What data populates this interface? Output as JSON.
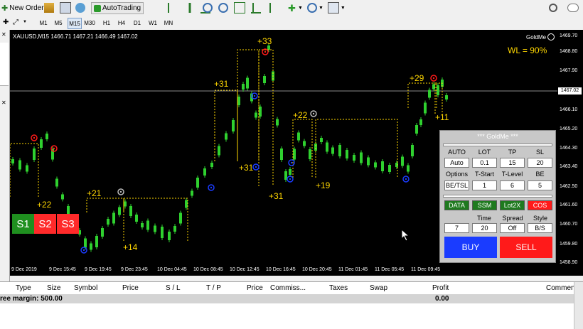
{
  "toolbar": {
    "new_order": "New Order",
    "autotrading": "AutoTrading"
  },
  "timeframes": [
    "M1",
    "M5",
    "M15",
    "M30",
    "H1",
    "H4",
    "D1",
    "W1",
    "MN"
  ],
  "active_timeframe": "M15",
  "chart": {
    "header": "XAUUSD,M15  1466.71 1467.21 1466.49 1467.02",
    "brand": "GoldMe",
    "winloss": "WL = 90%",
    "current_price": "1467.02",
    "price_ticks": [
      "1469.70",
      "1468.80",
      "1467.90",
      "1467.02",
      "1466.10",
      "1465.20",
      "1464.30",
      "1463.40",
      "1462.50",
      "1461.60",
      "1460.70",
      "1459.80",
      "1458.90"
    ],
    "date_ticks": [
      "9 Dec 2019",
      "9 Dec 15:45",
      "9 Dec 19:45",
      "9 Dec 23:45",
      "10 Dec 04:45",
      "10 Dec 08:45",
      "10 Dec 12:45",
      "10 Dec 16:45",
      "10 Dec 20:45",
      "11 Dec 01:45",
      "11 Dec 05:45",
      "11 Dec 09:45"
    ],
    "annotations": [
      "+22",
      "+21",
      "+14",
      "+31",
      "+33",
      "+31",
      "+22",
      "+31",
      "+19",
      "+29",
      "+11"
    ]
  },
  "panel": {
    "title": "*** GoldMe ***",
    "headers1": [
      "AUTO",
      "LOT",
      "TP",
      "SL"
    ],
    "values1": [
      "Auto",
      "0.1",
      "15",
      "20"
    ],
    "headers2": [
      "Options",
      "T-Start",
      "T-Level",
      "BE"
    ],
    "values2": [
      "BE/TSL",
      "1",
      "6",
      "5"
    ],
    "buttons": [
      "DATA",
      "SSM",
      "Lot2X",
      "COS"
    ],
    "headers3": [
      "Time",
      "Spread",
      "Style"
    ],
    "values3": [
      "7",
      "20",
      "Off",
      "B/S"
    ],
    "buy": "BUY",
    "sell": "SELL"
  },
  "signals": [
    "S1",
    "S2",
    "S3"
  ],
  "colors": {
    "buy": "#1a3cff",
    "sell": "#ff1a1a",
    "candle": "#2fd12f",
    "annotation": "#ffd700",
    "panel_green": "#1f7a1f"
  },
  "terminal": {
    "columns": [
      "Type",
      "Size",
      "Symbol",
      "Price",
      "S / L",
      "T / P",
      "Price",
      "Commiss...",
      "Taxes",
      "Swap",
      "Profit",
      "Comment"
    ],
    "margin_label": "ree margin: 500.00",
    "profit_value": "0.00"
  }
}
